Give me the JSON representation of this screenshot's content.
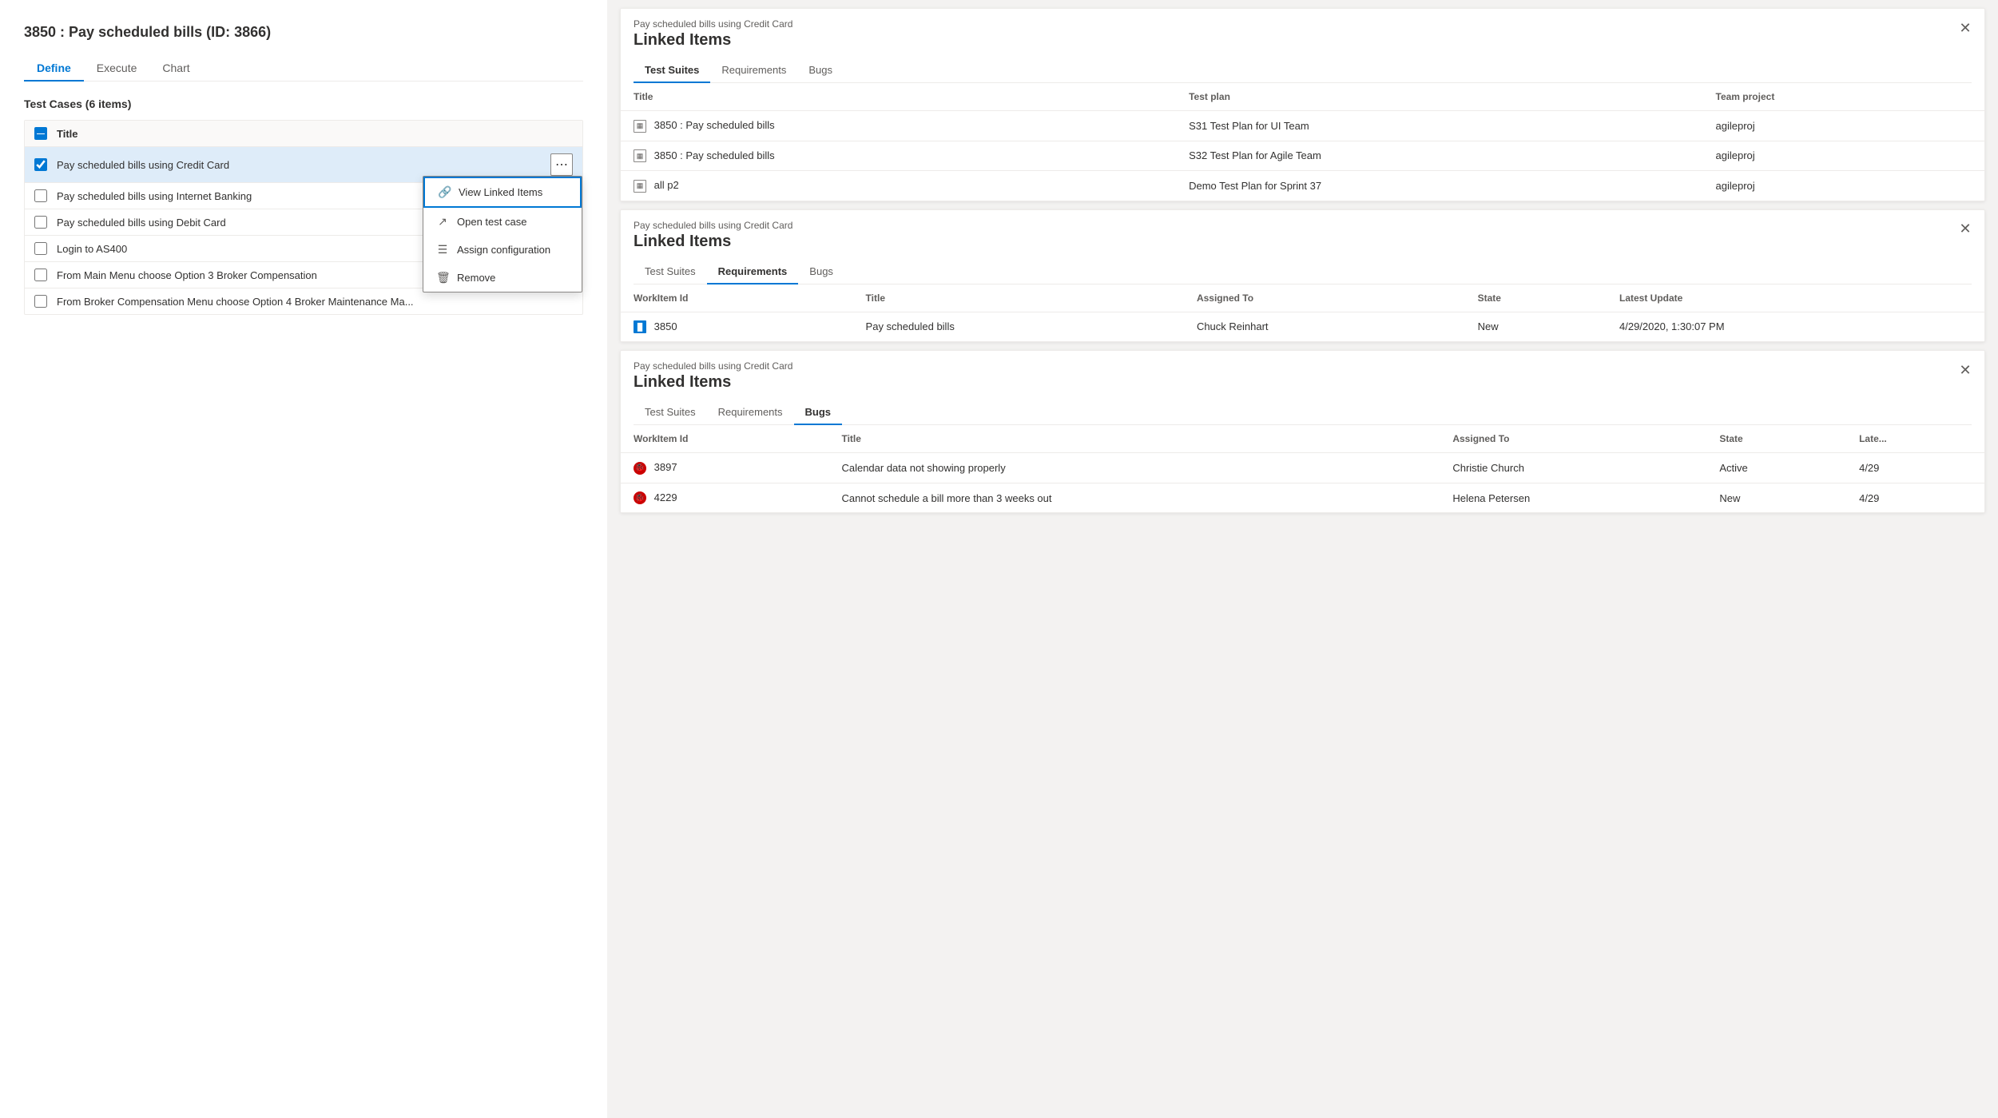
{
  "left": {
    "title": "3850 : Pay scheduled bills (ID: 3866)",
    "tabs": [
      {
        "id": "define",
        "label": "Define"
      },
      {
        "id": "execute",
        "label": "Execute"
      },
      {
        "id": "chart",
        "label": "Chart"
      }
    ],
    "activeTab": "define",
    "sectionTitle": "Test Cases (6 items)",
    "columnHeader": "Title",
    "testCases": [
      {
        "id": 1,
        "label": "Pay scheduled bills using Credit Card",
        "checked": true,
        "showMenu": true
      },
      {
        "id": 2,
        "label": "Pay scheduled bills using Internet Banking",
        "checked": false
      },
      {
        "id": 3,
        "label": "Pay scheduled bills using Debit Card",
        "checked": false
      },
      {
        "id": 4,
        "label": "Login to AS400",
        "checked": false
      },
      {
        "id": 5,
        "label": "From Main Menu choose Option 3 Broker Compensation",
        "checked": false
      },
      {
        "id": 6,
        "label": "From Broker Compensation Menu choose Option 4 Broker Maintenance Ma...",
        "checked": false
      }
    ],
    "contextMenu": {
      "items": [
        {
          "id": "view-linked",
          "icon": "🔗",
          "label": "View Linked Items",
          "highlighted": true
        },
        {
          "id": "open-test",
          "icon": "↗",
          "label": "Open test case"
        },
        {
          "id": "assign-config",
          "icon": "☰",
          "label": "Assign configuration"
        },
        {
          "id": "remove",
          "icon": "🗑",
          "label": "Remove"
        }
      ]
    }
  },
  "panels": [
    {
      "id": "panel-1",
      "subtitle": "Pay scheduled bills using Credit Card",
      "title": "Linked Items",
      "activeTab": "test-suites",
      "tabs": [
        {
          "id": "test-suites",
          "label": "Test Suites"
        },
        {
          "id": "requirements",
          "label": "Requirements"
        },
        {
          "id": "bugs",
          "label": "Bugs"
        }
      ],
      "tableHeaders": [
        "Title",
        "Test plan",
        "Team project"
      ],
      "rows": [
        {
          "icon": "suite",
          "title": "3850 : Pay scheduled bills",
          "testPlan": "S31 Test Plan for UI Team",
          "teamProject": "agileproj"
        },
        {
          "icon": "suite",
          "title": "3850 : Pay scheduled bills",
          "testPlan": "S32 Test Plan for Agile Team",
          "teamProject": "agileproj"
        },
        {
          "icon": "suite",
          "title": "all p2",
          "testPlan": "Demo Test Plan for Sprint 37",
          "teamProject": "agileproj"
        }
      ]
    },
    {
      "id": "panel-2",
      "subtitle": "Pay scheduled bills using Credit Card",
      "title": "Linked Items",
      "activeTab": "requirements",
      "tabs": [
        {
          "id": "test-suites",
          "label": "Test Suites"
        },
        {
          "id": "requirements",
          "label": "Requirements"
        },
        {
          "id": "bugs",
          "label": "Bugs"
        }
      ],
      "tableHeaders": [
        "WorkItem Id",
        "Title",
        "Assigned To",
        "State",
        "Latest Update"
      ],
      "rows": [
        {
          "icon": "wi-blue",
          "workItemId": "3850",
          "title": "Pay scheduled bills",
          "assignedTo": "Chuck Reinhart",
          "state": "New",
          "latestUpdate": "4/29/2020, 1:30:07 PM"
        }
      ]
    },
    {
      "id": "panel-3",
      "subtitle": "Pay scheduled bills using Credit Card",
      "title": "Linked Items",
      "activeTab": "bugs",
      "tabs": [
        {
          "id": "test-suites",
          "label": "Test Suites"
        },
        {
          "id": "requirements",
          "label": "Requirements"
        },
        {
          "id": "bugs",
          "label": "Bugs"
        }
      ],
      "tableHeaders": [
        "WorkItem Id",
        "Title",
        "Assigned To",
        "State",
        "Late..."
      ],
      "rows": [
        {
          "icon": "bug",
          "workItemId": "3897",
          "title": "Calendar data not showing properly",
          "assignedTo": "Christie Church",
          "state": "Active",
          "latestUpdate": "4/29"
        },
        {
          "icon": "bug",
          "workItemId": "4229",
          "title": "Cannot schedule a bill more than 3 weeks out",
          "assignedTo": "Helena Petersen",
          "state": "New",
          "latestUpdate": "4/29"
        }
      ]
    }
  ]
}
